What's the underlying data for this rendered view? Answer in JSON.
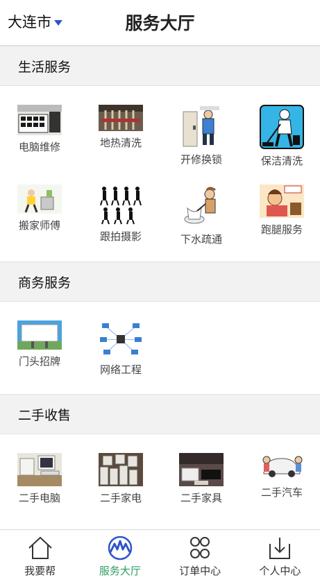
{
  "header": {
    "city": "大连市",
    "title": "服务大厅"
  },
  "sections": [
    {
      "title": "生活服务",
      "items": [
        {
          "label": "电脑维修",
          "icon": "computer-repair-icon"
        },
        {
          "label": "地热清洗",
          "icon": "floor-heating-icon"
        },
        {
          "label": "开修换锁",
          "icon": "locksmith-icon"
        },
        {
          "label": "保洁清洗",
          "icon": "cleaning-icon"
        },
        {
          "label": "搬家师傅",
          "icon": "moving-icon"
        },
        {
          "label": "跟拍摄影",
          "icon": "photography-icon"
        },
        {
          "label": "下水疏通",
          "icon": "drain-icon"
        },
        {
          "label": "跑腿服务",
          "icon": "errand-icon"
        }
      ]
    },
    {
      "title": "商务服务",
      "items": [
        {
          "label": "门头招牌",
          "icon": "signboard-icon"
        },
        {
          "label": "网络工程",
          "icon": "network-icon"
        }
      ]
    },
    {
      "title": "二手收售",
      "items": [
        {
          "label": "二手电脑",
          "icon": "used-computer-icon"
        },
        {
          "label": "二手家电",
          "icon": "used-appliance-icon"
        },
        {
          "label": "二手家具",
          "icon": "used-furniture-icon"
        },
        {
          "label": "二手汽车",
          "icon": "used-car-icon"
        }
      ]
    }
  ],
  "nav": [
    {
      "label": "我要帮",
      "icon": "home-icon",
      "active": false
    },
    {
      "label": "服务大厅",
      "icon": "service-hall-icon",
      "active": true
    },
    {
      "label": "订单中心",
      "icon": "grid-icon",
      "active": false
    },
    {
      "label": "个人中心",
      "icon": "download-icon",
      "active": false
    }
  ],
  "colors": {
    "accent": "#2e9e5f",
    "caret": "#2f55c8",
    "section_bg": "#f2f2f2"
  }
}
